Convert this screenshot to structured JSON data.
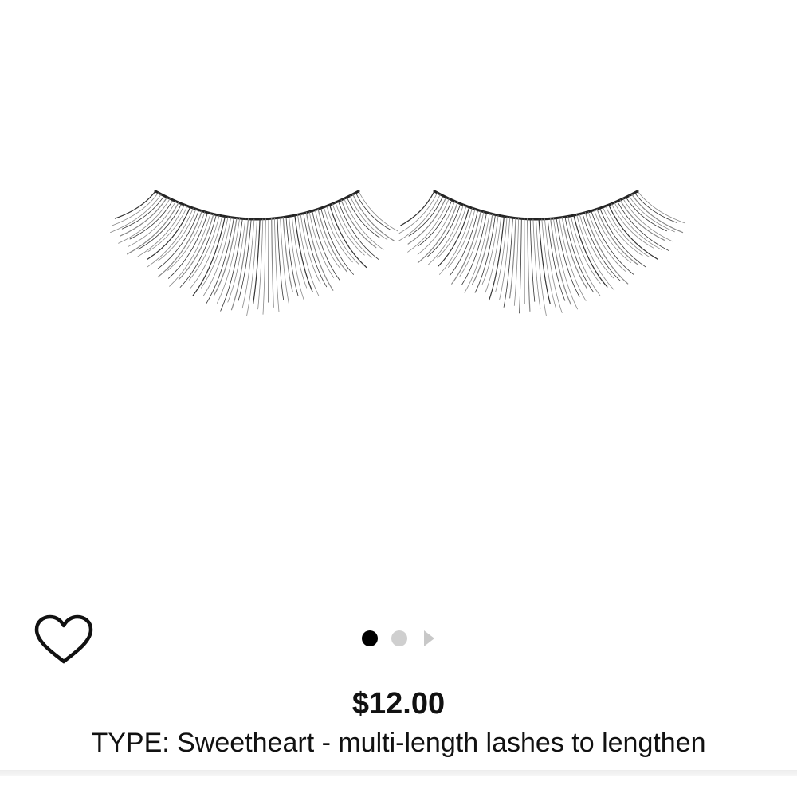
{
  "product": {
    "image": {
      "icon": "false-eyelashes-image"
    },
    "price": "$12.00",
    "type_line": "TYPE: Sweetheart - multi-length lashes to lengthen"
  },
  "favorite": {
    "icon": "heart-outline-icon"
  },
  "carousel": {
    "total_images": 2,
    "active_index": 1,
    "next_icon": "chevron-right-icon"
  },
  "colors": {
    "dot_active": "#000000",
    "dot_inactive": "#cfcfcf",
    "arrow": "#c8c8c8",
    "text": "#111111"
  }
}
